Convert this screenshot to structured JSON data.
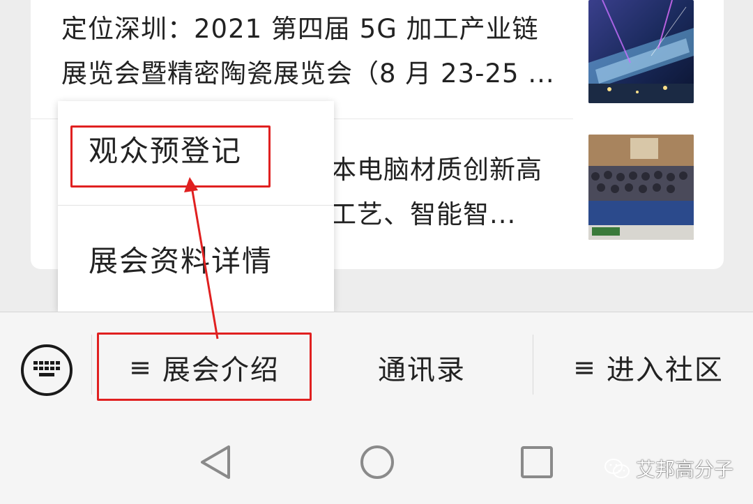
{
  "articles": [
    {
      "title": "定位深圳：2021 第四届 5G 加工产业链展览会暨精密陶瓷展览会（8 月 23-25 ...",
      "thumb_icon": "exhibition-hall-image"
    },
    {
      "title": "本电脑材质创新高 工艺、智能智...",
      "thumb_icon": "conference-audience-image"
    }
  ],
  "dropdown": {
    "items": [
      {
        "label": "观众预登记"
      },
      {
        "label": "展会资料详情"
      }
    ]
  },
  "bottom_menu": {
    "keyboard_icon": "keyboard-icon",
    "tabs": [
      {
        "glyph": "≡",
        "label": "展会介绍"
      },
      {
        "glyph": "",
        "label": "通讯录"
      },
      {
        "glyph": "≡",
        "label": "进入社区"
      }
    ]
  },
  "nav": {
    "back_icon": "back-triangle-icon",
    "home_icon": "home-circle-icon",
    "recent_icon": "recent-square-icon"
  },
  "watermark": {
    "text": "艾邦高分子",
    "icon": "wechat-icon"
  },
  "colors": {
    "highlight": "#e02020",
    "menu_bg": "#f5f5f5",
    "card_bg": "#ffffff"
  }
}
